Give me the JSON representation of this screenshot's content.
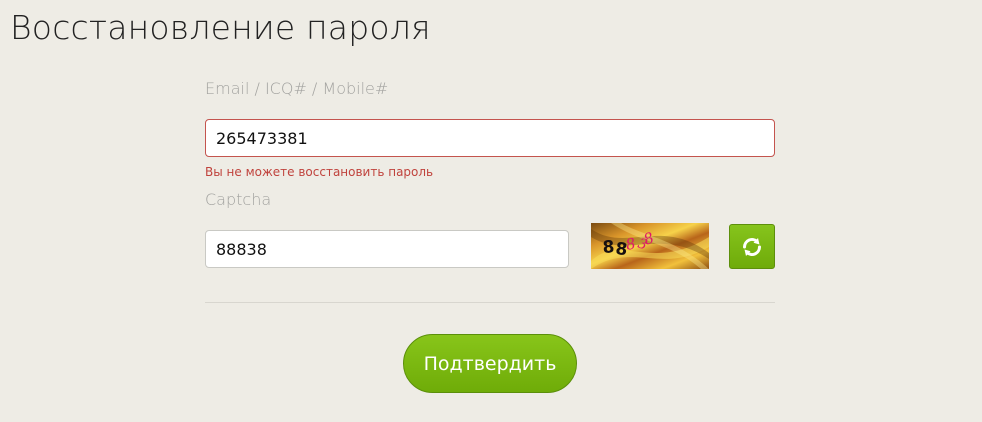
{
  "page": {
    "title": "Восстановление пароля"
  },
  "form": {
    "login_label": "Email / ICQ# / Mobile#",
    "login_value": "265473381",
    "error_message": "Вы не можете восстановить пароль",
    "captcha_label": "Captcha",
    "captcha_value": "88838",
    "captcha_image_text": "88838",
    "refresh_icon": "refresh-icon",
    "submit_label": "Подтвердить"
  },
  "colors": {
    "background": "#eeece5",
    "accent_green": "#7ab80f",
    "error_red": "#c0433d",
    "input_error_border": "#c4544e"
  }
}
